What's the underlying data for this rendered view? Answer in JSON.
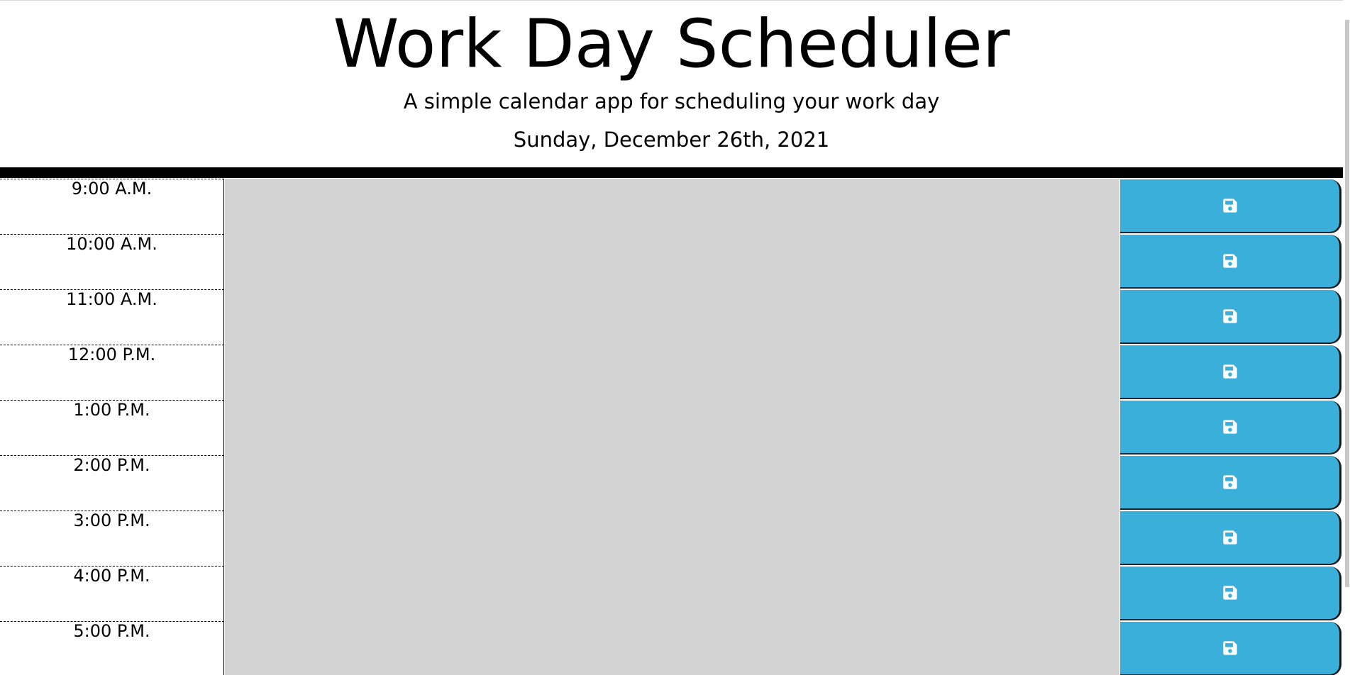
{
  "header": {
    "title": "Work Day Scheduler",
    "lead": "A simple calendar app for scheduling your work day",
    "current_day": "Sunday, December 26th, 2021"
  },
  "schedule": {
    "rows": [
      {
        "hour": "9:00 A.M.",
        "description": "",
        "save_icon": "save-icon"
      },
      {
        "hour": "10:00 A.M.",
        "description": "",
        "save_icon": "save-icon"
      },
      {
        "hour": "11:00 A.M.",
        "description": "",
        "save_icon": "save-icon"
      },
      {
        "hour": "12:00 P.M.",
        "description": "",
        "save_icon": "save-icon"
      },
      {
        "hour": "1:00 P.M.",
        "description": "",
        "save_icon": "save-icon"
      },
      {
        "hour": "2:00 P.M.",
        "description": "",
        "save_icon": "save-icon"
      },
      {
        "hour": "3:00 P.M.",
        "description": "",
        "save_icon": "save-icon"
      },
      {
        "hour": "4:00 P.M.",
        "description": "",
        "save_icon": "save-icon"
      },
      {
        "hour": "5:00 P.M.",
        "description": "",
        "save_icon": "save-icon"
      }
    ]
  },
  "colors": {
    "past_row": "#d3d3d3",
    "save_button": "#3aafd9",
    "header_bar": "#000000"
  }
}
